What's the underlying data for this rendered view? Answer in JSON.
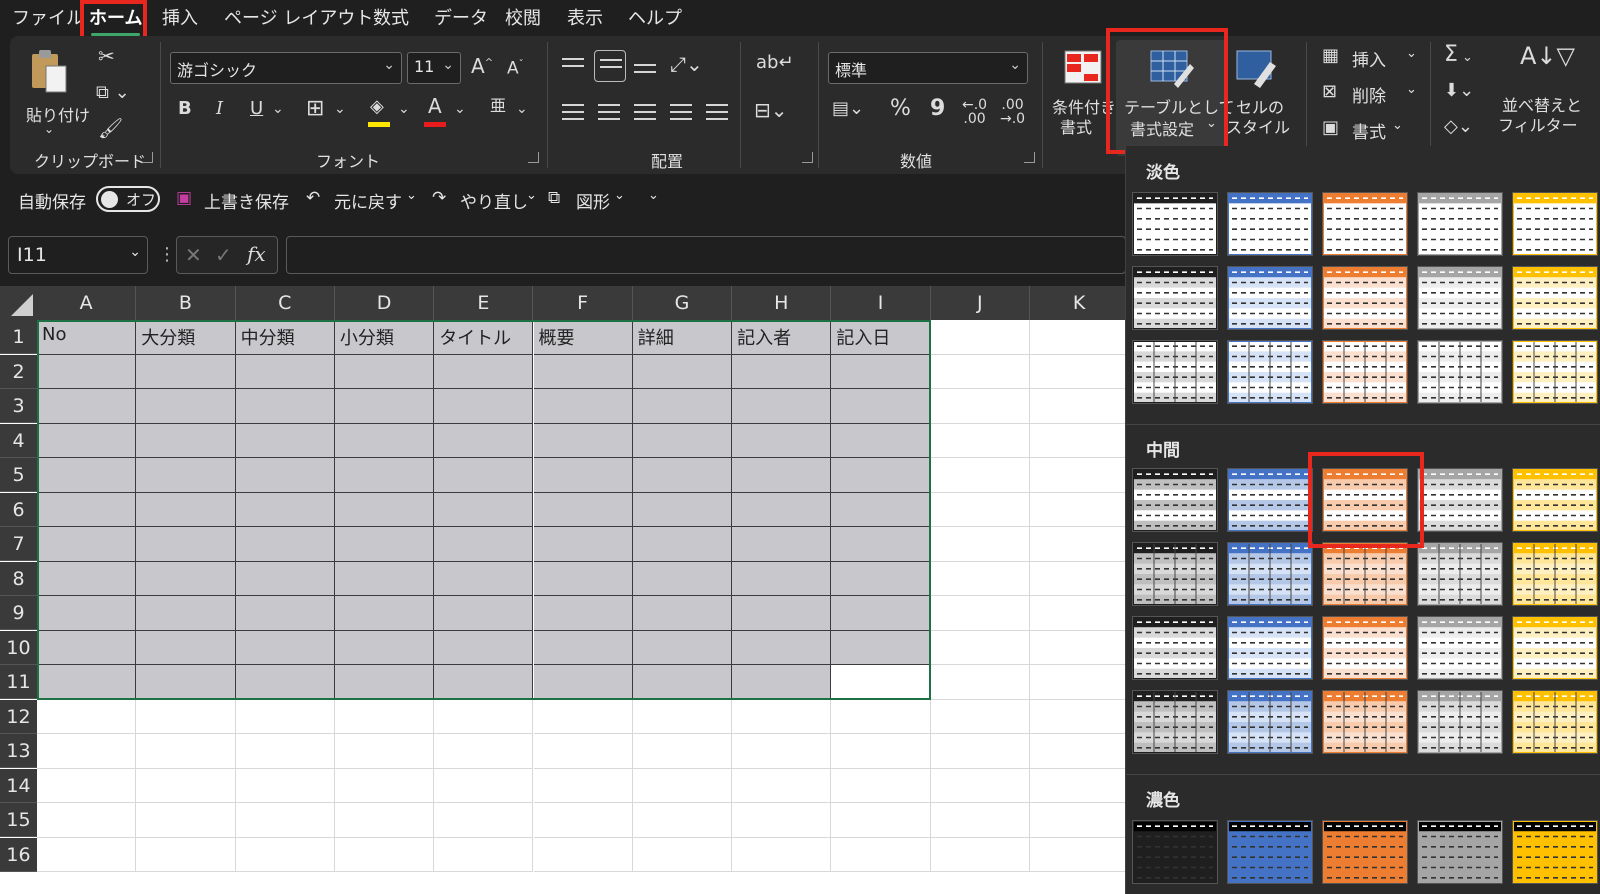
{
  "menu": {
    "tabs": [
      "ファイル",
      "ホーム",
      "挿入",
      "ページ レイアウト",
      "数式",
      "データ",
      "校閲",
      "表示",
      "ヘルプ"
    ],
    "active_tab": "ホーム"
  },
  "ribbon": {
    "clipboard": {
      "paste_label": "貼り付け",
      "group_label": "クリップボード"
    },
    "font": {
      "font_name": "游ゴシック",
      "font_size": "11",
      "grow": "A",
      "shrink": "A",
      "bold": "B",
      "italic": "I",
      "underline": "U",
      "group_label": "フォント"
    },
    "alignment": {
      "group_label": "配置"
    },
    "number": {
      "format": "標準",
      "percent": "%",
      "comma": "9",
      "group_label": "数値"
    },
    "styles": {
      "conditional_line1": "条件付き",
      "conditional_line2": "書式",
      "table_line1": "テーブルとして",
      "table_line2": "書式設定",
      "cell_line1": "セルの",
      "cell_line2": "スタイル"
    },
    "cells": {
      "insert": "挿入",
      "delete": "削除",
      "format": "書式"
    },
    "editing": {
      "sigma": "Σ",
      "sort_line1": "並べ替えと",
      "sort_line2": "フィルター"
    }
  },
  "qat": {
    "autosave_label": "自動保存",
    "autosave_state": "オフ",
    "save_label": "上書き保存",
    "undo_label": "元に戻す",
    "redo_label": "やり直し",
    "shapes_label": "図形"
  },
  "formula_bar": {
    "name_box": "I11",
    "fx": "fx",
    "value": ""
  },
  "sheet": {
    "columns": [
      "A",
      "B",
      "C",
      "D",
      "E",
      "F",
      "G",
      "H",
      "I",
      "J",
      "K"
    ],
    "rows": [
      "1",
      "2",
      "3",
      "4",
      "5",
      "6",
      "7",
      "8",
      "9",
      "10",
      "11",
      "12",
      "13",
      "14",
      "15",
      "16"
    ],
    "headers": [
      "No",
      "大分類",
      "中分類",
      "小分類",
      "タイトル",
      "概要",
      "詳細",
      "記入者",
      "記入日"
    ]
  },
  "gallery": {
    "sections": [
      "淡色",
      "中間",
      "濃色"
    ],
    "colors": {
      "black": "#1f1f1f",
      "blue": "#4472c4",
      "orange": "#ed7d31",
      "gray": "#a5a5a5",
      "gold": "#ffc000"
    }
  },
  "accent": {
    "highlight": "#e8281f",
    "selection": "#1e7145"
  }
}
